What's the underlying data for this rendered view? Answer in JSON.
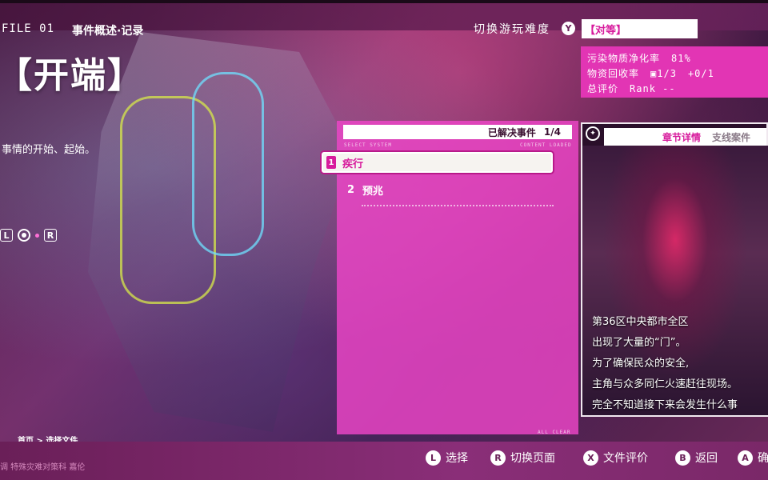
{
  "header": {
    "file_label": "FILE 01",
    "section_title": "事件概述·记录",
    "difficulty_label": "切换游玩难度",
    "difficulty_button": "Y",
    "difficulty_value": "【对等】"
  },
  "chapter": {
    "title": "【开端】",
    "description": "事情的开始、起始。",
    "nav_left": "L",
    "nav_right": "R"
  },
  "stats": {
    "purification_label": "污染物质净化率",
    "purification_value": "81%",
    "recovery_label": "物资回收率",
    "recovery_box": "1/3",
    "recovery_plus": "+0/1",
    "rank_label": "总评价",
    "rank_value": "Rank --"
  },
  "case_list": {
    "header_label": "已解决事件",
    "header_count": "1/4",
    "micro_left": "SELECT SYSTEM",
    "micro_right": "CONTENT LOADED",
    "items": [
      {
        "num": "1",
        "label": "疾行"
      },
      {
        "num": "2",
        "label": "预兆"
      }
    ],
    "micro_bottom": "ALL CLEAR"
  },
  "detail": {
    "tab_active": "章节详情",
    "tab_inactive": "支线案件",
    "lines": [
      "第36区中央都市全区",
      "出现了大量的“门”。",
      "为了确保民众的安全,",
      "主角与众多同仁火速赶往现场。",
      "完全不知道接下来会发生什么事"
    ]
  },
  "footer": {
    "breadcrumb": "首页 > 选择文件",
    "left_text": "调 特殊灾难对策科 嘉伦",
    "hints": [
      {
        "btn": "L",
        "label": "选择"
      },
      {
        "btn": "R",
        "label": "切换页面"
      },
      {
        "btn": "X",
        "label": "文件评价"
      },
      {
        "btn": "B",
        "label": "返回"
      },
      {
        "btn": "A",
        "label": "确"
      }
    ]
  },
  "colors": {
    "accent": "#d71a9c",
    "panel_pink": "#ee46c8",
    "stats_pink": "#e235b4"
  }
}
